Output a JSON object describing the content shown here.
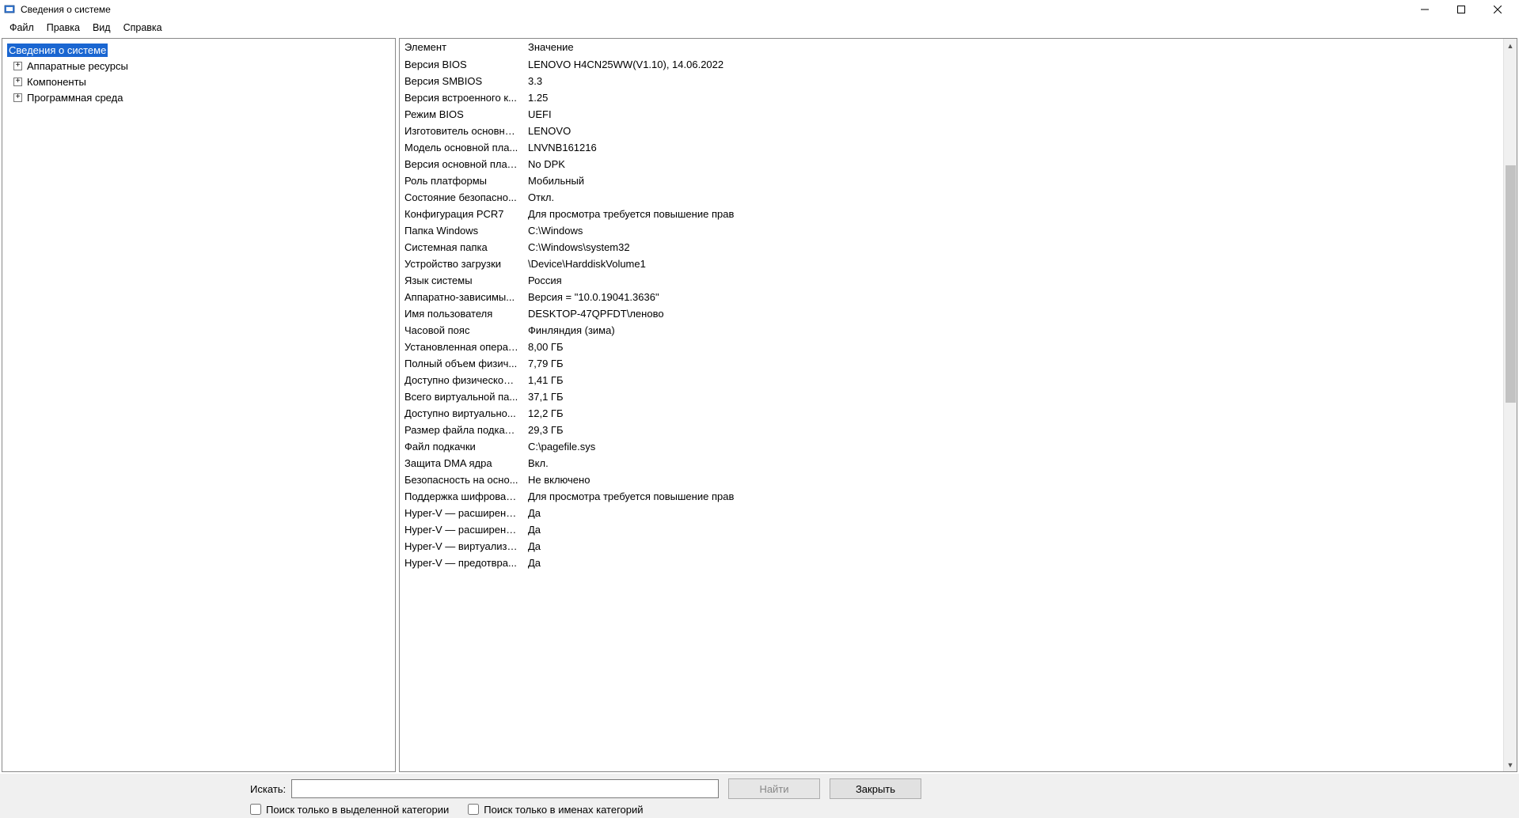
{
  "window": {
    "title": "Сведения о системе"
  },
  "menu": {
    "file": "Файл",
    "edit": "Правка",
    "view": "Вид",
    "help": "Справка"
  },
  "tree": {
    "root": "Сведения о системе",
    "children": [
      "Аппаратные ресурсы",
      "Компоненты",
      "Программная среда"
    ]
  },
  "details": {
    "header_name": "Элемент",
    "header_value": "Значение",
    "rows": [
      {
        "name": "Версия BIOS",
        "value": "LENOVO H4CN25WW(V1.10), 14.06.2022"
      },
      {
        "name": "Версия SMBIOS",
        "value": "3.3"
      },
      {
        "name": "Версия встроенного к...",
        "value": "1.25"
      },
      {
        "name": "Режим BIOS",
        "value": "UEFI"
      },
      {
        "name": "Изготовитель основно...",
        "value": "LENOVO"
      },
      {
        "name": "Модель основной пла...",
        "value": "LNVNB161216"
      },
      {
        "name": "Версия основной платы",
        "value": "No DPK"
      },
      {
        "name": "Роль платформы",
        "value": "Мобильный"
      },
      {
        "name": "Состояние безопасно...",
        "value": "Откл."
      },
      {
        "name": "Конфигурация PCR7",
        "value": "Для просмотра требуется повышение прав"
      },
      {
        "name": "Папка Windows",
        "value": "C:\\Windows"
      },
      {
        "name": "Системная папка",
        "value": "C:\\Windows\\system32"
      },
      {
        "name": "Устройство загрузки",
        "value": "\\Device\\HarddiskVolume1"
      },
      {
        "name": "Язык системы",
        "value": "Россия"
      },
      {
        "name": "Аппаратно-зависимы...",
        "value": "Версия = \"10.0.19041.3636\""
      },
      {
        "name": "Имя пользователя",
        "value": "DESKTOP-47QPFDT\\леново"
      },
      {
        "name": "Часовой пояс",
        "value": "Финляндия (зима)"
      },
      {
        "name": "Установленная операт...",
        "value": "8,00 ГБ"
      },
      {
        "name": "Полный объем физич...",
        "value": "7,79 ГБ"
      },
      {
        "name": "Доступно физической ...",
        "value": "1,41 ГБ"
      },
      {
        "name": "Всего виртуальной па...",
        "value": "37,1 ГБ"
      },
      {
        "name": "Доступно виртуально...",
        "value": "12,2 ГБ"
      },
      {
        "name": "Размер файла подкачки",
        "value": "29,3 ГБ"
      },
      {
        "name": "Файл подкачки",
        "value": "C:\\pagefile.sys"
      },
      {
        "name": "Защита DMA ядра",
        "value": "Вкл."
      },
      {
        "name": "Безопасность на осно...",
        "value": "Не включено"
      },
      {
        "name": "Поддержка шифрован...",
        "value": "Для просмотра требуется повышение прав"
      },
      {
        "name": "Hyper-V — расширени...",
        "value": "Да"
      },
      {
        "name": "Hyper-V — расширени...",
        "value": "Да"
      },
      {
        "name": "Hyper-V — виртуализа...",
        "value": "Да"
      },
      {
        "name": "Hyper-V — предотвра...",
        "value": "Да"
      }
    ]
  },
  "search": {
    "label": "Искать:",
    "value": "",
    "find_btn": "Найти",
    "close_btn": "Закрыть",
    "check_selected": "Поиск только в выделенной категории",
    "check_names": "Поиск только в именах категорий"
  }
}
